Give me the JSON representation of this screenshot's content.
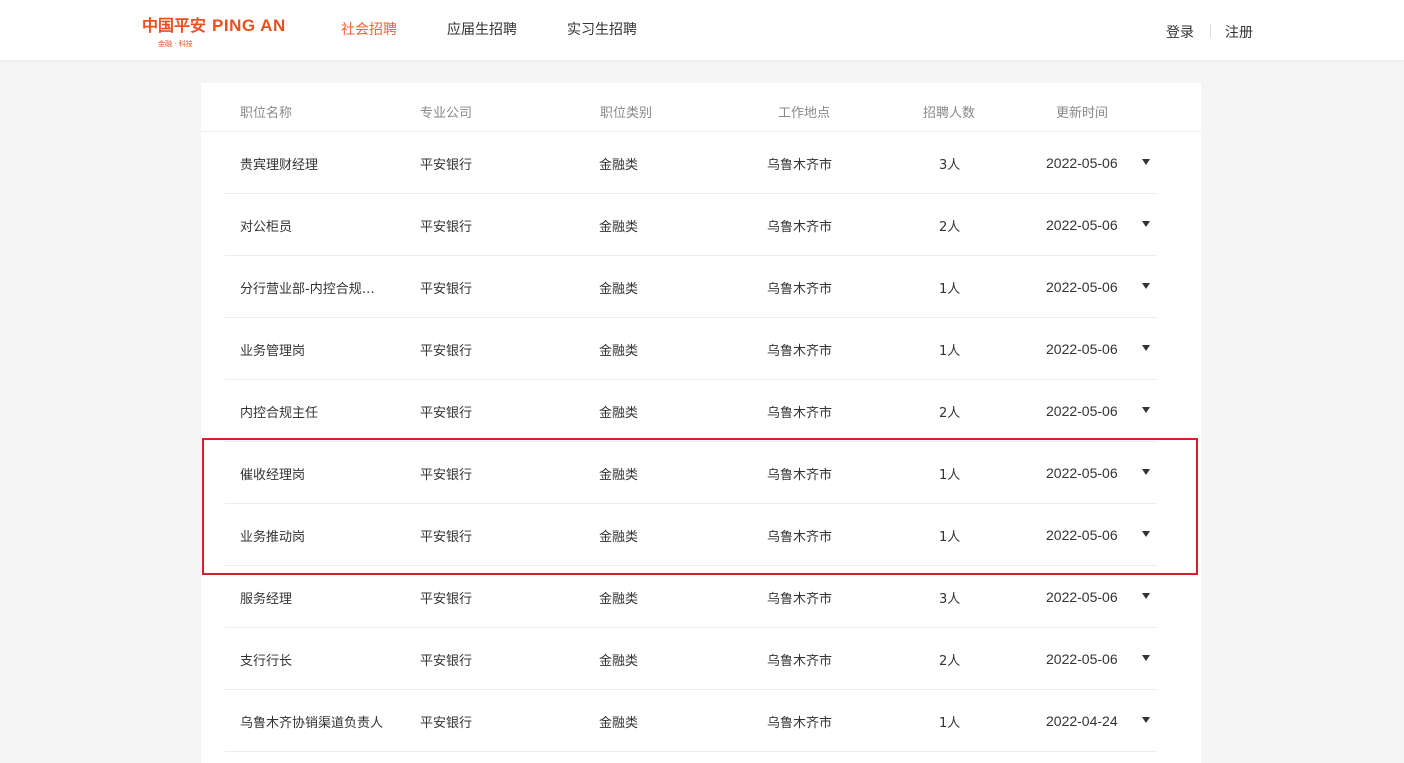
{
  "brand": {
    "cn": "中国平安",
    "en": "PING AN",
    "tagline": "金融 · 科技",
    "color": "#e8511f"
  },
  "nav": [
    {
      "label": "社会招聘",
      "active": true
    },
    {
      "label": "应届生招聘",
      "active": false
    },
    {
      "label": "实习生招聘",
      "active": false
    }
  ],
  "auth": {
    "login": "登录",
    "register": "注册"
  },
  "table": {
    "headers": [
      "职位名称",
      "专业公司",
      "职位类别",
      "工作地点",
      "招聘人数",
      "更新时间"
    ],
    "rows": [
      {
        "title": "贵宾理财经理",
        "company": "平安银行",
        "category": "金融类",
        "location": "乌鲁木齐市",
        "count": "3人",
        "date": "2022-05-06"
      },
      {
        "title": "对公柜员",
        "company": "平安银行",
        "category": "金融类",
        "location": "乌鲁木齐市",
        "count": "2人",
        "date": "2022-05-06"
      },
      {
        "title": "分行营业部-内控合规…",
        "company": "平安银行",
        "category": "金融类",
        "location": "乌鲁木齐市",
        "count": "1人",
        "date": "2022-05-06"
      },
      {
        "title": "业务管理岗",
        "company": "平安银行",
        "category": "金融类",
        "location": "乌鲁木齐市",
        "count": "1人",
        "date": "2022-05-06"
      },
      {
        "title": "内控合规主任",
        "company": "平安银行",
        "category": "金融类",
        "location": "乌鲁木齐市",
        "count": "2人",
        "date": "2022-05-06"
      },
      {
        "title": "催收经理岗",
        "company": "平安银行",
        "category": "金融类",
        "location": "乌鲁木齐市",
        "count": "1人",
        "date": "2022-05-06"
      },
      {
        "title": "业务推动岗",
        "company": "平安银行",
        "category": "金融类",
        "location": "乌鲁木齐市",
        "count": "1人",
        "date": "2022-05-06"
      },
      {
        "title": "服务经理",
        "company": "平安银行",
        "category": "金融类",
        "location": "乌鲁木齐市",
        "count": "3人",
        "date": "2022-05-06"
      },
      {
        "title": "支行行长",
        "company": "平安银行",
        "category": "金融类",
        "location": "乌鲁木齐市",
        "count": "2人",
        "date": "2022-05-06"
      },
      {
        "title": "乌鲁木齐协销渠道负责人",
        "company": "平安银行",
        "category": "金融类",
        "location": "乌鲁木齐市",
        "count": "1人",
        "date": "2022-04-24"
      }
    ]
  },
  "highlight": {
    "rows": [
      "催收经理岗",
      "业务推动岗"
    ],
    "color": "#d6202a"
  }
}
